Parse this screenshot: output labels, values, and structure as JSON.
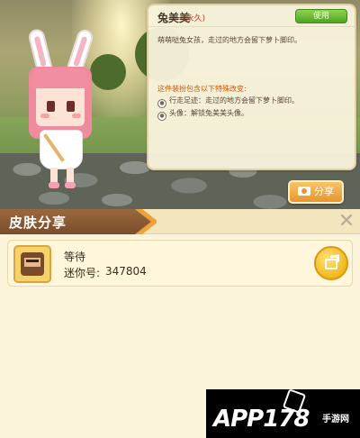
{
  "skin": {
    "name": "兔美美",
    "tag": "(永久)",
    "use_label": "使用",
    "description": "萌萌哒兔女孩，走过的地方会留下萝卜脚印。",
    "special_title": "这件装扮包含以下特殊改变:",
    "features": [
      {
        "text": "行走足迹：走过的地方会留下萝卜脚印。",
        "icon": "footprint-icon"
      },
      {
        "text": "头像：解锁兔美美头像。",
        "icon": "avatar-icon"
      }
    ],
    "share_label": "分享"
  },
  "dialog": {
    "title": "皮肤分享",
    "close_glyph": "✕",
    "user": {
      "name": "等待",
      "mini_id_label": "迷你号:",
      "mini_id": "347804"
    }
  },
  "watermark": {
    "text": "APP178",
    "sub": "手游网"
  }
}
